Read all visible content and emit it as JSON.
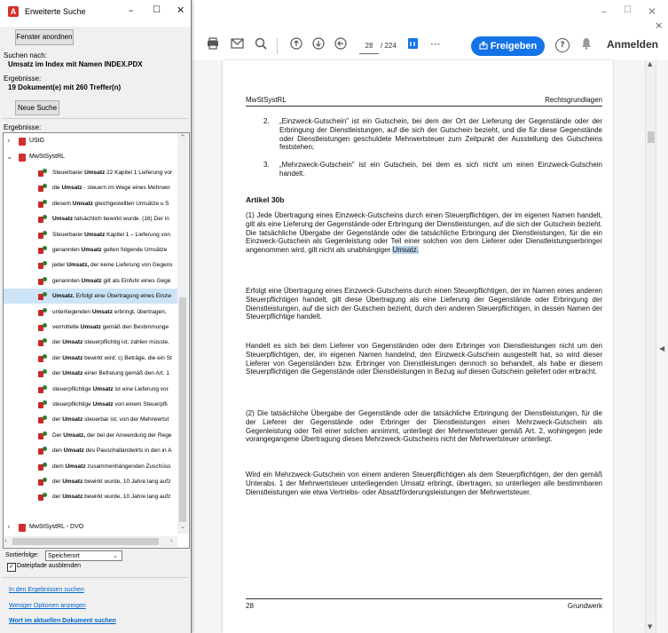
{
  "dialog": {
    "title": "Erweiterte Suche",
    "window_controls": {
      "minimize": "–",
      "maximize": "☐",
      "close": "✕"
    },
    "arrange_button": "Fenster anordnen",
    "search_for_label": "Suchen nach:",
    "search_for_value": "Umsatz im Index mit Namen INDEX.PDX",
    "results_label": "Ergebnisse:",
    "results_value": "19 Dokument(e) mit 260 Treffer(n)",
    "new_search_button": "Neue Suche",
    "results_list_label": "Ergebnisse:",
    "tree": {
      "ustg": "UStG",
      "mwstsystrl": "MwStSystRL",
      "mwstsystrl_dvo": "MwStSystRL - DVO"
    },
    "results": [
      {
        "pre": "Steuerbarer ",
        "hit": "Umsatz",
        "post": " 22 Kapitel 1 Lieferung vor"
      },
      {
        "pre": "die ",
        "hit": "Umsatz",
        "post": " - steuern im Wege eines Mehrwer"
      },
      {
        "pre": "diesem ",
        "hit": "Umsatz",
        "post": " gleichgestellten Umsätze u S"
      },
      {
        "pre": "",
        "hit": "Umsatz",
        "post": " tatsächlich bewirkt wurde. (16) Der in"
      },
      {
        "pre": "Steuerbarer ",
        "hit": "Umsatz",
        "post": " Kapitel 1 – Lieferung von"
      },
      {
        "pre": "genannten ",
        "hit": "Umsatz",
        "post": " gelten folgende Umsätze "
      },
      {
        "pre": "jeder ",
        "hit": "Umsatz,",
        "post": " der keine Lieferung von Gegens"
      },
      {
        "pre": "genannten ",
        "hit": "Umsatz",
        "post": " gilt als Einfuhr eines Gege"
      },
      {
        "pre": "",
        "hit": "Umsatz.",
        "post": " Erfolgt eine Übertragung eines Einzw"
      },
      {
        "pre": "unterliegenden ",
        "hit": "Umsatz",
        "post": " erbringt, übertragen,"
      },
      {
        "pre": "vermittelte ",
        "hit": "Umsatz",
        "post": " gemäß den Bestimmunge"
      },
      {
        "pre": "der ",
        "hit": "Umsatz",
        "post": " steuerpflichtig ist, zahlen müsste,"
      },
      {
        "pre": "der ",
        "hit": "Umsatz",
        "post": " bewirkt wird; c) Beträge, die ein St"
      },
      {
        "pre": "der ",
        "hit": "Umsatz",
        "post": " einer Befreiung gemäß den Art. 1"
      },
      {
        "pre": "steuerpflichtige ",
        "hit": "Umsatz",
        "post": " ist eine Lieferung vor"
      },
      {
        "pre": "steuerpflichtige ",
        "hit": "Umsatz",
        "post": " von einem Steuerpfli"
      },
      {
        "pre": "der ",
        "hit": "Umsatz",
        "post": " steuerbar ist, von der Mehrwertst"
      },
      {
        "pre": "Der ",
        "hit": "Umsatz,",
        "post": " der bei der Anwendung der Rege"
      },
      {
        "pre": "den ",
        "hit": "Umsatz",
        "post": " des Pauschallandwirts in den in A"
      },
      {
        "pre": "dem ",
        "hit": "Umsatz",
        "post": " zusammenhängenden Zuschüss"
      },
      {
        "pre": "der ",
        "hit": "Umsatz",
        "post": " bewirkt wurde, 10 Jahre lang aufz"
      },
      {
        "pre": "der ",
        "hit": "Umsatz",
        "post": " bewirkt wurde, 10 Jahre lang aufz"
      }
    ],
    "selected_result_index": 8,
    "sort_label": "Sortierfolge:",
    "sort_value": "Speicherort",
    "hide_paths_label": "Dateipfade ausblenden",
    "hide_paths_checked": true,
    "links": {
      "search_in_results": "In den Ergebnissen suchen",
      "fewer_options": "Weniger Optionen anzeigen",
      "whole_word_current": "Wort im aktuellen Dokument suchen"
    }
  },
  "viewer": {
    "window_controls": {
      "minimize": "–",
      "maximize": "☐",
      "close": "✕",
      "close_tab": "×"
    },
    "page_current": "28",
    "page_total": "/ 224",
    "more": "···",
    "share_button": "Freigeben",
    "help": "?",
    "sign_in": "Anmelden"
  },
  "page": {
    "header_left": "MwStSystRL",
    "header_right": "Rechtsgrundlagen",
    "items": [
      {
        "num": "2.",
        "text": "„Einzweck-Gutschein\" ist ein Gutschein, bei dem der Ort der Lieferung der Gegenstände oder der Erbringung der Dienstleistungen, auf die sich der Gutschein bezieht, und die für diese Gegenstände oder Dienstleistungen geschuldete Mehrwertsteuer zum Zeitpunkt der Ausstellung des Gutscheins feststehen;"
      },
      {
        "num": "3.",
        "text": "„Mehrzweck-Gutschein\" ist ein Gutschein, bei dem es sich nicht um einen Einzweck-Gutschein handelt."
      }
    ],
    "article": "Artikel 30b",
    "para1_pre": "(1) Jede Übertragung eines Einzweck-Gutscheins durch einen Steuerpflichtigen, der im eigenen Namen handelt, gilt als eine Lieferung der Gegenstände oder Erbringung der Dienstleistungen, auf die sich der Gutschein bezieht. Die tatsächliche Übergabe der Gegenstände oder die tatsächliche Erbringung der Dienstleistungen, für die ein Einzweck-Gutschein als Gegenleistung oder Teil einer solchen von dem Lieferer oder Dienstleistungserbringer angenommen wird, gilt nicht als unabhängiger",
    "para1_hit": "Umsatz.",
    "para2": "Erfolgt eine Übertragung eines Einzweck-Gutscheins durch einen Steuerpflichtigen, der im Namen eines anderen Steuerpflichtigen handelt, gilt diese Übertragung als eine Lieferung der Gegenstände oder Erbringung der Dienstleistungen, auf die sich der Gutschein bezieht, durch den anderen Steuerpflichtigen, in dessen Namen der Steuerpflichtige handelt.",
    "para3": "Handelt es sich bei dem Lieferer von Gegenständen oder dem Erbringer von Dienstleistungen nicht um den Steuerpflichtigen, der, im eigenen Namen handelnd, den Einzweck-Gutschein ausgestellt hat, so wird dieser Lieferer von Gegenständen bzw. Erbringer von Dienstleistungen dennoch so behandelt, als habe er diesem Steuerpflichtigen die Gegenstände oder Dienstleistungen in Bezug auf diesen Gutschein geliefert oder erbracht.",
    "para4": "(2) Die tatsächliche Übergabe der Gegenstände oder die tatsächliche Erbringung der Dienstleistungen, für die der Lieferer der Gegenstände oder Erbringer der Dienstleistungen einen Mehrzweck-Gutschein als Gegenleistung oder Teil einer solchen annimmt, unterliegt der Mehrwertsteuer gemäß Art. 2, wohingegen jede vorangegangene Übertragung dieses Mehrzweck-Gutscheins nicht der Mehrwertsteuer unterliegt.",
    "para5": "Wird ein Mehrzweck-Gutschein von einem anderen Steuerpflichtigen als dem Steuerpflichtigen, der den gemäß Unterabs. 1 der Mehrwertsteuer unterliegenden Umsatz erbringt, übertragen, so unterliegen alle bestimmbaren Dienstleistungen wie etwa Vertriebs- oder Absatzförderungsleistungen der Mehrwertsteuer.",
    "footer_left": "28",
    "footer_right": "Grundwerk"
  }
}
